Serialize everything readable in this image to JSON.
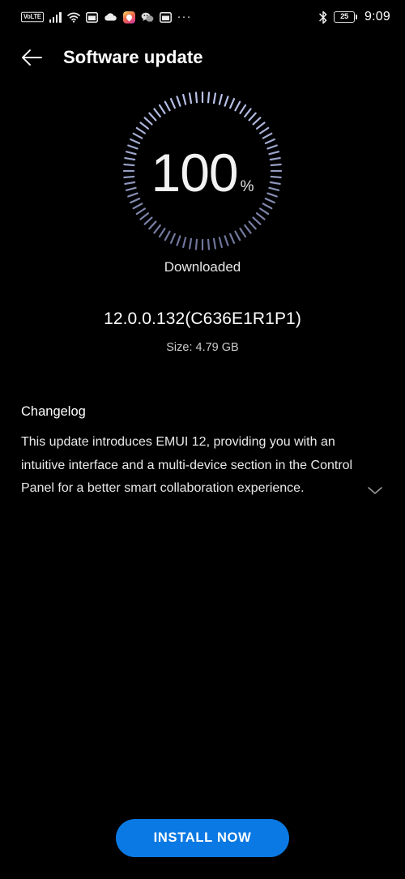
{
  "status_bar": {
    "carrier_badge": "VoLTE",
    "icons": [
      "signal-bars-icon",
      "wifi-icon",
      "window-card-icon",
      "cloud-icon",
      "location-pin-app-icon",
      "wechat-icon",
      "window-card-icon",
      "more-dots-icon"
    ],
    "bluetooth_icon": "bluetooth-icon",
    "battery_level": "25",
    "time": "9:09"
  },
  "app_bar": {
    "back_icon": "arrow-left-icon",
    "title": "Software update"
  },
  "progress": {
    "percent_value": "100",
    "percent_sign": "%",
    "percent_number": 100,
    "status_label": "Downloaded",
    "tick_count": 76,
    "tick_color_light": "#b9c2e8",
    "tick_color_dark": "#4d55a8"
  },
  "update": {
    "version": "12.0.0.132(C636E1R1P1)",
    "size": "Size: 4.79 GB"
  },
  "changelog": {
    "title": "Changelog",
    "body": "This update introduces EMUI 12, providing you with an intuitive interface and a multi-device section in the Control Panel for a better smart collaboration experience.",
    "expand_icon": "chevron-down-icon"
  },
  "footer": {
    "install_label": "INSTALL NOW",
    "install_color": "#0b79e3"
  }
}
